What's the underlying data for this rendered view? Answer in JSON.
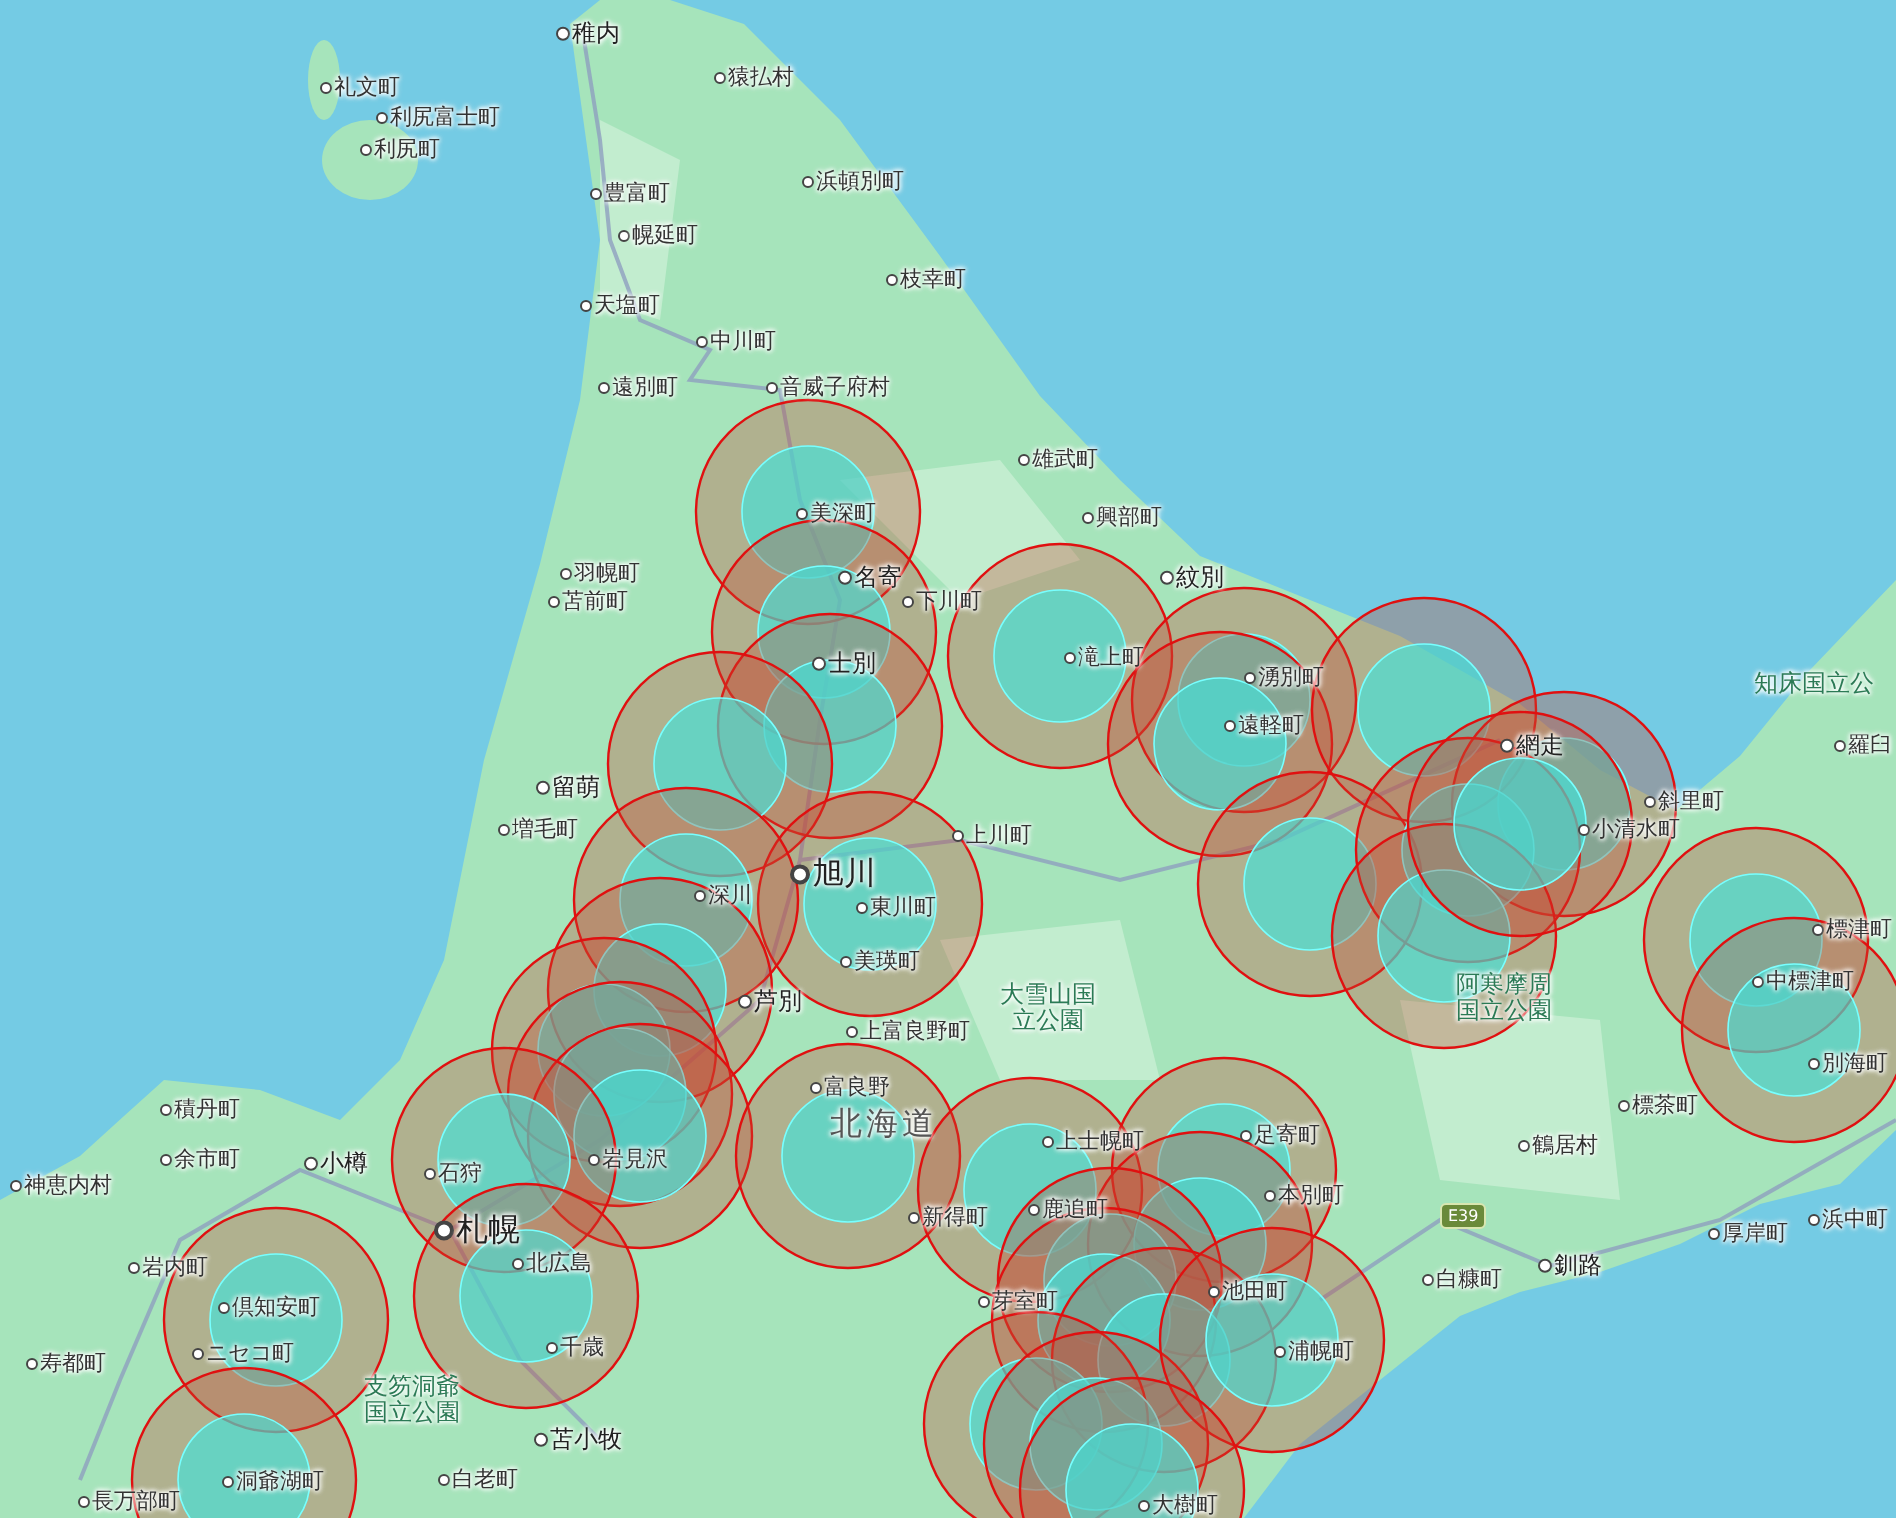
{
  "map": {
    "labels": [
      {
        "text": "稚内",
        "kind": "city"
      },
      {
        "text": "礼文町",
        "kind": "town"
      },
      {
        "text": "利尻富士町",
        "kind": "town"
      },
      {
        "text": "利尻町",
        "kind": "town"
      },
      {
        "text": "猿払村",
        "kind": "town"
      },
      {
        "text": "豊富町",
        "kind": "town"
      },
      {
        "text": "浜頓別町",
        "kind": "town"
      },
      {
        "text": "幌延町",
        "kind": "town"
      },
      {
        "text": "枝幸町",
        "kind": "town"
      },
      {
        "text": "天塩町",
        "kind": "town"
      },
      {
        "text": "中川町",
        "kind": "town"
      },
      {
        "text": "遠別町",
        "kind": "town"
      },
      {
        "text": "音威子府村",
        "kind": "town"
      },
      {
        "text": "美深町",
        "kind": "town"
      },
      {
        "text": "雄武町",
        "kind": "town"
      },
      {
        "text": "興部町",
        "kind": "town"
      },
      {
        "text": "羽幌町",
        "kind": "town"
      },
      {
        "text": "名寄",
        "kind": "city"
      },
      {
        "text": "苫前町",
        "kind": "town"
      },
      {
        "text": "下川町",
        "kind": "town"
      },
      {
        "text": "紋別",
        "kind": "city"
      },
      {
        "text": "滝上町",
        "kind": "town"
      },
      {
        "text": "湧別町",
        "kind": "town"
      },
      {
        "text": "士別",
        "kind": "city"
      },
      {
        "text": "遠軽町",
        "kind": "town"
      },
      {
        "text": "留萌",
        "kind": "city"
      },
      {
        "text": "増毛町",
        "kind": "town"
      },
      {
        "text": "上川町",
        "kind": "town"
      },
      {
        "text": "網走",
        "kind": "city"
      },
      {
        "text": "斜里町",
        "kind": "town"
      },
      {
        "text": "知床国立公",
        "kind": "park_line"
      },
      {
        "text": "羅臼",
        "kind": "town"
      },
      {
        "text": "小清水町",
        "kind": "town"
      },
      {
        "text": "旭川",
        "kind": "major_city"
      },
      {
        "text": "深川",
        "kind": "town"
      },
      {
        "text": "東川町",
        "kind": "town"
      },
      {
        "text": "美瑛町",
        "kind": "town"
      },
      {
        "text": "芦別",
        "kind": "city"
      },
      {
        "text": "大雪山国立公園",
        "kind": "park"
      },
      {
        "text": "上富良野町",
        "kind": "town"
      },
      {
        "text": "阿寒摩周国立公園",
        "kind": "park"
      },
      {
        "text": "標津町",
        "kind": "town"
      },
      {
        "text": "中標津町",
        "kind": "town"
      },
      {
        "text": "別海町",
        "kind": "town"
      },
      {
        "text": "富良野",
        "kind": "town"
      },
      {
        "text": "北海道",
        "kind": "region"
      },
      {
        "text": "上士幌町",
        "kind": "town"
      },
      {
        "text": "足寄町",
        "kind": "town"
      },
      {
        "text": "積丹町",
        "kind": "town"
      },
      {
        "text": "余市町",
        "kind": "town_left"
      },
      {
        "text": "小樽",
        "kind": "city"
      },
      {
        "text": "神恵内村",
        "kind": "town_left"
      },
      {
        "text": "石狩",
        "kind": "town"
      },
      {
        "text": "岩見沢",
        "kind": "town"
      },
      {
        "text": "標茶町",
        "kind": "town"
      },
      {
        "text": "鶴居村",
        "kind": "town"
      },
      {
        "text": "本別町",
        "kind": "town"
      },
      {
        "text": "新得町",
        "kind": "town_left"
      },
      {
        "text": "鹿追町",
        "kind": "town"
      },
      {
        "text": "札幌",
        "kind": "major_city"
      },
      {
        "text": "岩内町",
        "kind": "town"
      },
      {
        "text": "北広島",
        "kind": "town"
      },
      {
        "text": "倶知安町",
        "kind": "town"
      },
      {
        "text": "E39",
        "kind": "highway"
      },
      {
        "text": "白糠町",
        "kind": "town"
      },
      {
        "text": "釧路",
        "kind": "city"
      },
      {
        "text": "厚岸町",
        "kind": "town"
      },
      {
        "text": "浜中町",
        "kind": "town"
      },
      {
        "text": "芽室町",
        "kind": "town"
      },
      {
        "text": "池田町",
        "kind": "town"
      },
      {
        "text": "浦幌町",
        "kind": "town"
      },
      {
        "text": "寿都町",
        "kind": "town"
      },
      {
        "text": "ニセコ町",
        "kind": "town"
      },
      {
        "text": "千歳",
        "kind": "town"
      },
      {
        "text": "支笏洞爺国立公園",
        "kind": "park"
      },
      {
        "text": "苫小牧",
        "kind": "city"
      },
      {
        "text": "洞爺湖町",
        "kind": "town"
      },
      {
        "text": "白老町",
        "kind": "town"
      },
      {
        "text": "長万部町",
        "kind": "town"
      },
      {
        "text": "大樹町",
        "kind": "town"
      }
    ]
  }
}
